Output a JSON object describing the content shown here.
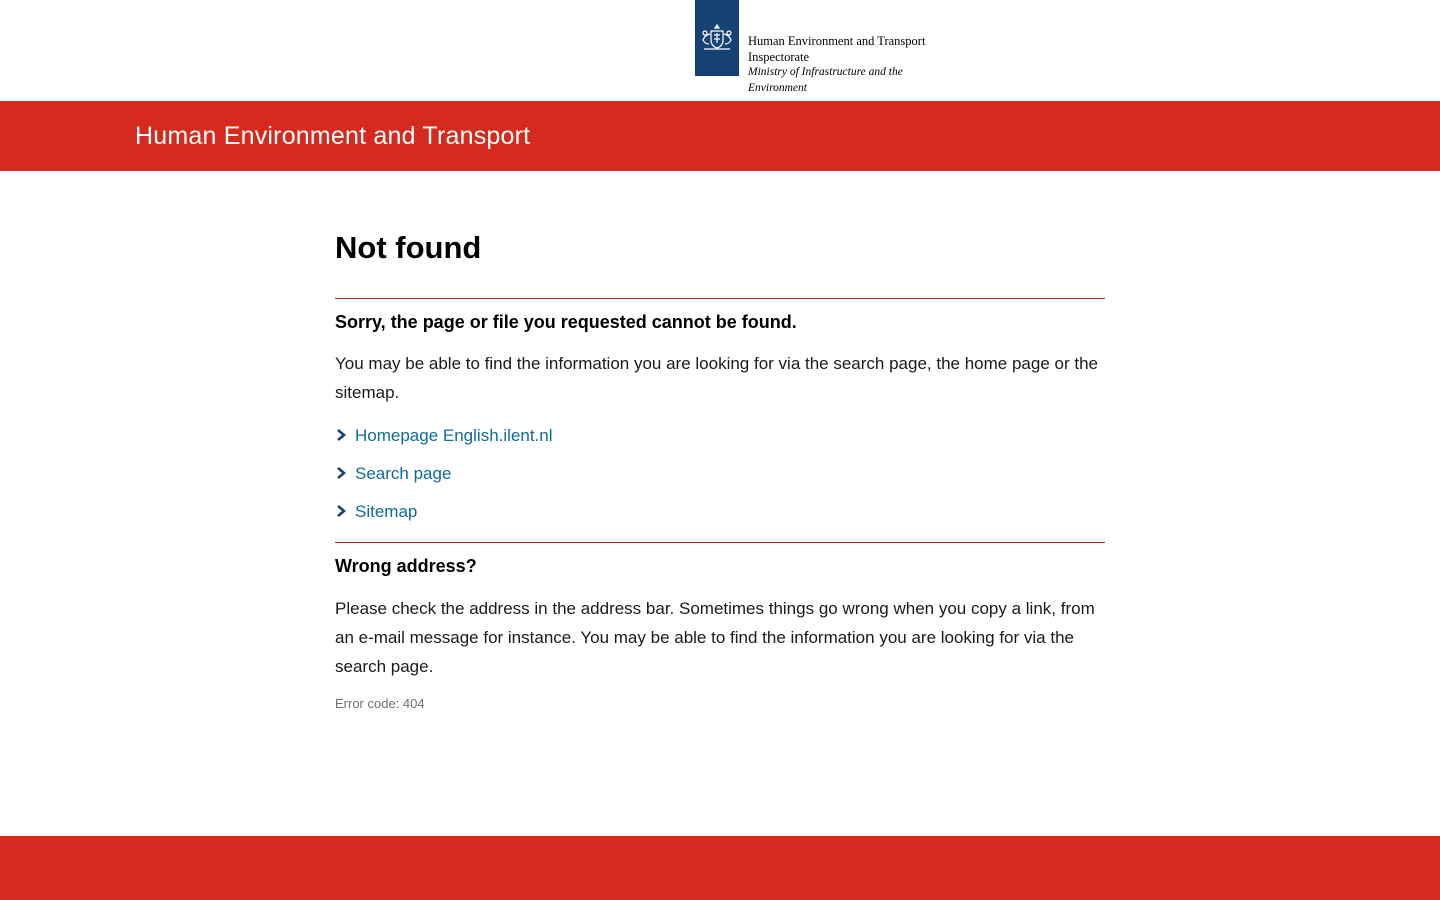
{
  "header": {
    "logo_lines": [
      "Human Environment and Transport",
      "Inspectorate"
    ],
    "logo_sub_lines": [
      "Ministry of Infrastructure and the",
      "Environment"
    ],
    "logo_icon": "coat-of-arms-icon"
  },
  "banner": {
    "title": "Human Environment and Transport"
  },
  "main": {
    "title": "Not found",
    "section1_title": "Sorry, the page or file you requested cannot be found.",
    "section1_text": "You may be able to find the information you are looking for via the search page, the home page or the sitemap.",
    "links": [
      {
        "label": "Homepage English.ilent.nl",
        "icon": "chevron-right-icon"
      },
      {
        "label": "Search page",
        "icon": "chevron-right-icon"
      },
      {
        "label": "Sitemap",
        "icon": "chevron-right-icon"
      }
    ],
    "section2_title": "Wrong address?",
    "section2_text": "Please check the address in the address bar. Sometimes things go wrong when you copy a link, from an e-mail message for instance. You may be able to find the information you are looking for via the search page.",
    "error_code": "Error code: 404"
  },
  "colors": {
    "brand_red": "#d52b1e",
    "logo_blue": "#154273",
    "link_blue": "#0f6a9a",
    "rule": "#a0351d"
  }
}
